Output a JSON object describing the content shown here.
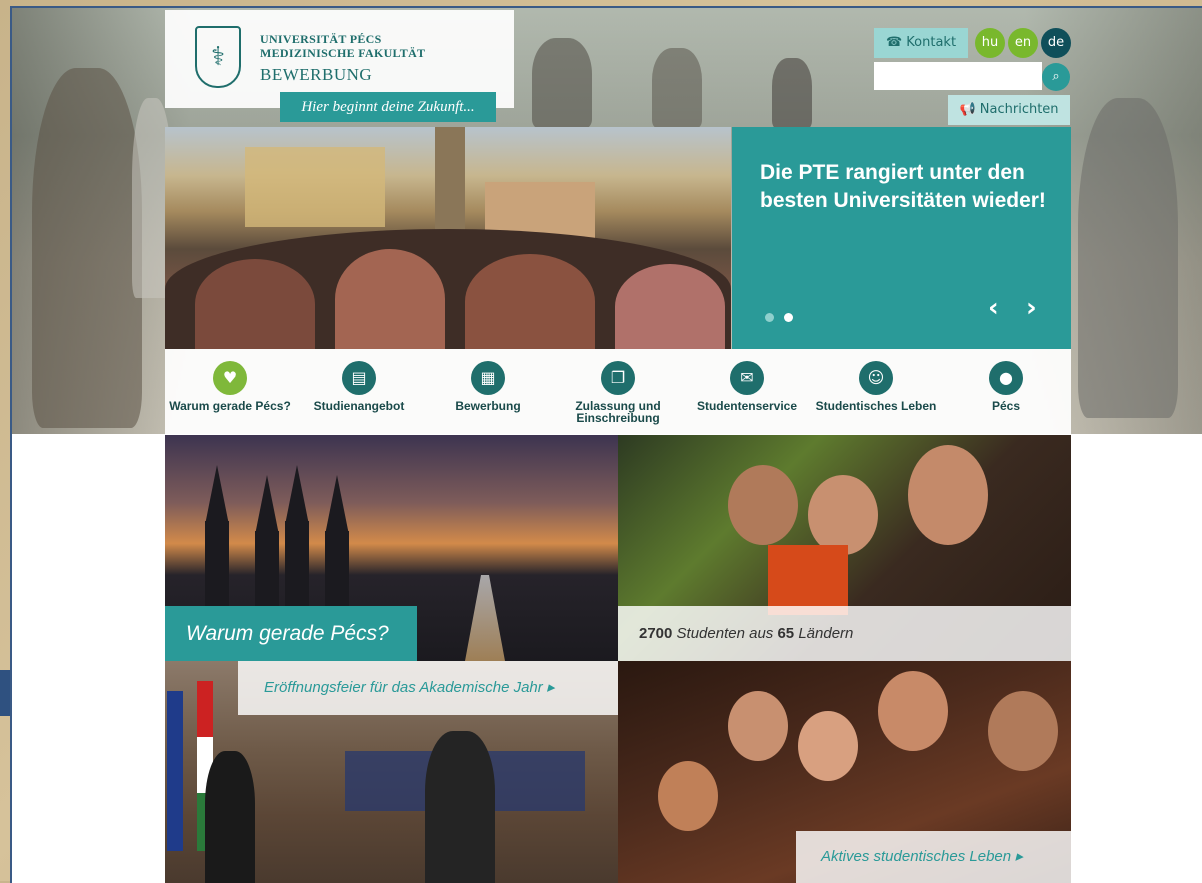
{
  "header": {
    "university_line1": "UNIVERSITÄT PÉCS",
    "university_line2": "MEDIZINISCHE FAKULTÄT",
    "section_title": "BEWERBUNG",
    "slogan": "Hier beginnt deine Zukunft..."
  },
  "utility": {
    "contact_label": "Kontakt",
    "languages": [
      "hu",
      "en",
      "de"
    ],
    "language_colors": [
      "#79b82d",
      "#79b82d",
      "#0f4f5a"
    ],
    "active_language": "de",
    "search_placeholder": "",
    "news_label": "Nachrichten"
  },
  "slider": {
    "title": "Die PTE rangiert unter den besten Universitäten wieder!",
    "slide_count": 2,
    "active_slide": 2,
    "prev_label": "‹",
    "next_label": "›"
  },
  "nav": {
    "items": [
      {
        "label": "Warum gerade Pécs?",
        "icon": "heart-icon",
        "glyph": "♥",
        "color": "#7fb83a"
      },
      {
        "label": "Studienangebot",
        "icon": "book-icon",
        "glyph": "▤",
        "color": "#1f6e6c"
      },
      {
        "label": "Bewerbung",
        "icon": "document-icon",
        "glyph": "▦",
        "color": "#1f6e6c"
      },
      {
        "label": "Zulassung und Einschreibung",
        "icon": "copy-icon",
        "glyph": "❐",
        "color": "#1f6e6c"
      },
      {
        "label": "Studentenservice",
        "icon": "gift-icon",
        "glyph": "✉",
        "color": "#1f6e6c"
      },
      {
        "label": "Studentisches Leben",
        "icon": "users-icon",
        "glyph": "☺",
        "color": "#1f6e6c"
      },
      {
        "label": "Pécs",
        "icon": "map-pin-icon",
        "glyph": "●",
        "color": "#1f6e6c"
      }
    ]
  },
  "tiles": {
    "city_label": "Warum gerade Pécs?",
    "students_count": "2700",
    "students_text1": "Studenten aus",
    "countries_count": "65",
    "students_text2": "Ländern",
    "ceremony_label": "Eröffnungsfeier für das Akademische Jahr ▸",
    "life_label": "Aktives studentisches Leben ▸"
  },
  "colors": {
    "accent": "#2a9a98",
    "accent_dark": "#1f6e6c",
    "accent_green": "#79b82d"
  }
}
